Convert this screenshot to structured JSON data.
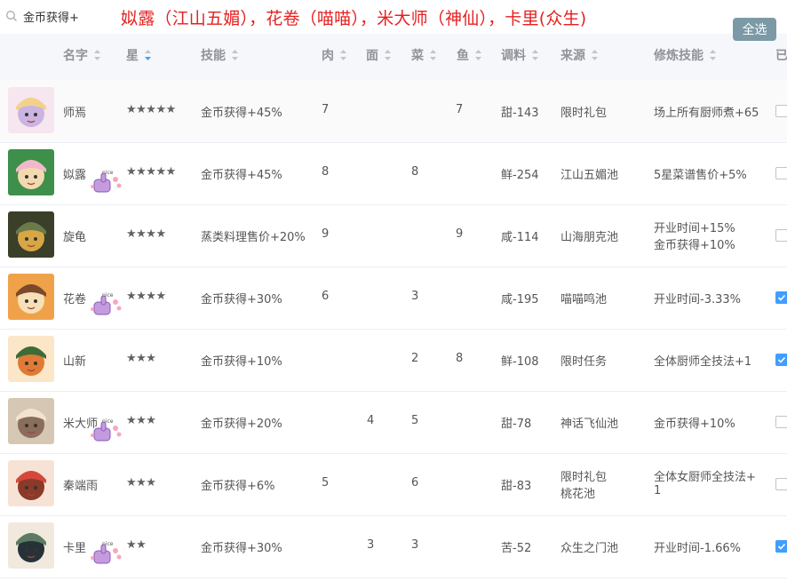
{
  "search": {
    "value": "金币获得+"
  },
  "annotation": "姒露（江山五媚），花卷（喵喵），米大师（神仙），卡里(众生)",
  "select_all_label": "全选",
  "columns": [
    "名字",
    "星",
    "技能",
    "肉",
    "面",
    "菜",
    "鱼",
    "调料",
    "来源",
    "修炼技能",
    "已"
  ],
  "sticker_text": "nice",
  "colors": {
    "accent": "#409eff",
    "annotation": "#e62020",
    "button": "#7b9aa6"
  },
  "rows": [
    {
      "name": "师焉",
      "stars": "★★★★★",
      "skill": "金币获得+45%",
      "meat": "7",
      "noodle": "",
      "veg": "",
      "fish": "7",
      "seasoning": "甜-143",
      "source1": "限时礼包",
      "source2": "",
      "train1": "场上所有厨师煮+65",
      "train2": "",
      "checked": false
    },
    {
      "name": "姒露",
      "stars": "★★★★★",
      "skill": "金币获得+45%",
      "meat": "8",
      "noodle": "",
      "veg": "8",
      "fish": "",
      "seasoning": "鲜-254",
      "source1": "江山五媚池",
      "source2": "",
      "train1": "5星菜谱售价+5%",
      "train2": "",
      "checked": false
    },
    {
      "name": "旋龟",
      "stars": "★★★★",
      "skill": "蒸类料理售价+20%",
      "meat": "9",
      "noodle": "",
      "veg": "",
      "fish": "9",
      "seasoning": "咸-114",
      "source1": "山海朋克池",
      "source2": "",
      "train1": "开业时间+15%",
      "train2": "金币获得+10%",
      "checked": false
    },
    {
      "name": "花卷",
      "stars": "★★★★",
      "skill": "金币获得+30%",
      "meat": "6",
      "noodle": "",
      "veg": "3",
      "fish": "",
      "seasoning": "咸-195",
      "source1": "喵喵鸣池",
      "source2": "",
      "train1": "开业时间-3.33%",
      "train2": "",
      "checked": true
    },
    {
      "name": "山新",
      "stars": "★★★",
      "skill": "金币获得+10%",
      "meat": "",
      "noodle": "",
      "veg": "2",
      "fish": "8",
      "seasoning": "鲜-108",
      "source1": "限时任务",
      "source2": "",
      "train1": "全体厨师全技法+1",
      "train2": "",
      "checked": true
    },
    {
      "name": "米大师",
      "stars": "★★★",
      "skill": "金币获得+20%",
      "meat": "",
      "noodle": "4",
      "veg": "5",
      "fish": "",
      "seasoning": "甜-78",
      "source1": "神话飞仙池",
      "source2": "",
      "train1": "金币获得+10%",
      "train2": "",
      "checked": false
    },
    {
      "name": "秦端雨",
      "stars": "★★★",
      "skill": "金币获得+6%",
      "meat": "5",
      "noodle": "",
      "veg": "6",
      "fish": "",
      "seasoning": "甜-83",
      "source1": "限时礼包",
      "source2": "桃花池",
      "train1": "全体女厨师全技法+",
      "train2": "1",
      "checked": false
    },
    {
      "name": "卡里",
      "stars": "★★",
      "skill": "金币获得+30%",
      "meat": "",
      "noodle": "3",
      "veg": "3",
      "fish": "",
      "seasoning": "苦-52",
      "source1": "众生之门池",
      "source2": "",
      "train1": "开业时间-1.66%",
      "train2": "",
      "checked": true
    }
  ]
}
